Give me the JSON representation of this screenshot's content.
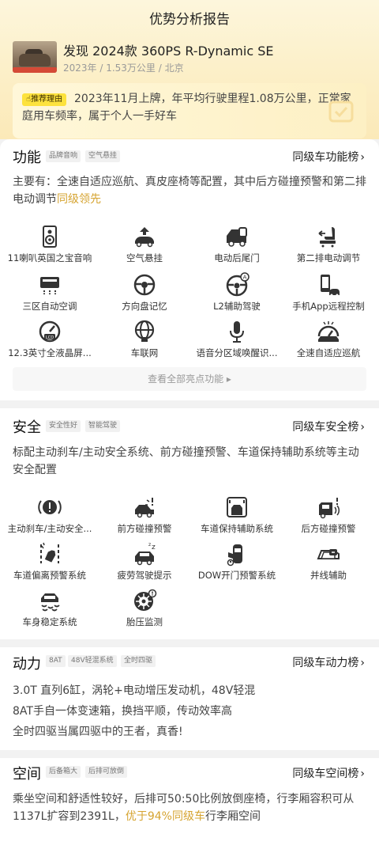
{
  "page_title": "优势分析报告",
  "car": {
    "name": "发现 2024款 360PS R-Dynamic SE",
    "meta": "2023年 / 1.53万公里 / 北京"
  },
  "reason": {
    "badge": "推荐理由",
    "text": "2023年11月上牌，年平均行驶里程1.08万公里，正常家庭用车频率，属于个人一手好车"
  },
  "function": {
    "title": "功能",
    "tags": [
      "品牌音响",
      "空气悬挂"
    ],
    "rank_link": "同级车功能榜",
    "desc_prefix": "主要有：全速自适应巡航、真皮座椅等配置，其中后方碰撞预警和第二排电动调节",
    "desc_highlight": "同级领先",
    "features": [
      {
        "icon": "speaker-icon",
        "label": "11喇叭英国之宝音响"
      },
      {
        "icon": "air-suspension-icon",
        "label": "空气悬挂"
      },
      {
        "icon": "power-tailgate-icon",
        "label": "电动后尾门"
      },
      {
        "icon": "power-seat-icon",
        "label": "第二排电动调节"
      },
      {
        "icon": "climate-control-icon",
        "label": "三区自动空调"
      },
      {
        "icon": "steering-wheel-icon",
        "label": "方向盘记忆"
      },
      {
        "icon": "driver-assist-icon",
        "label": "L2辅助驾驶"
      },
      {
        "icon": "phone-remote-icon",
        "label": "手机App远程控制"
      },
      {
        "icon": "lcd-gauge-icon",
        "label": "12.3英寸全液晶屏..."
      },
      {
        "icon": "connected-car-icon",
        "label": "车联网"
      },
      {
        "icon": "microphone-icon",
        "label": "语音分区域唤醒识..."
      },
      {
        "icon": "cruise-control-icon",
        "label": "全速自适应巡航"
      }
    ],
    "view_all": "查看全部亮点功能 ▸"
  },
  "safety": {
    "title": "安全",
    "tags": [
      "安全性好",
      "智能驾驶"
    ],
    "rank_link": "同级车安全榜",
    "desc": "标配主动刹车/主动安全系统、前方碰撞预警、车道保持辅助系统等主动安全配置",
    "features": [
      {
        "icon": "brake-warning-icon",
        "label": "主动刹车/主动安全..."
      },
      {
        "icon": "front-collision-icon",
        "label": "前方碰撞预警"
      },
      {
        "icon": "lane-keep-icon",
        "label": "车道保持辅助系统"
      },
      {
        "icon": "rear-collision-icon",
        "label": "后方碰撞预警"
      },
      {
        "icon": "lane-departure-icon",
        "label": "车道偏离预警系统"
      },
      {
        "icon": "fatigue-icon",
        "label": "疲劳驾驶提示"
      },
      {
        "icon": "door-open-warning-icon",
        "label": "DOW开门预警系统"
      },
      {
        "icon": "lane-merge-icon",
        "label": "并线辅助"
      },
      {
        "icon": "stability-icon",
        "label": "车身稳定系统"
      },
      {
        "icon": "tire-pressure-icon",
        "label": "胎压监测"
      }
    ]
  },
  "power": {
    "title": "动力",
    "tags": [
      "8AT",
      "48V轻混系统",
      "全时四驱"
    ],
    "rank_link": "同级车动力榜",
    "lines": [
      "3.0T 直列6缸，涡轮+电动增压发动机，48V轻混",
      "8AT手自一体变速箱，换挡平顺，传动效率高",
      "全时四驱当属四驱中的王者，真香!"
    ]
  },
  "space": {
    "title": "空间",
    "tags": [
      "后备箱大",
      "后排可放倒"
    ],
    "rank_link": "同级车空间榜",
    "desc_prefix": "乘坐空间和舒适性较好，后排可50:50比例放倒座椅，行李厢容积可从1137L扩容到2391L，",
    "desc_highlight": "优于94%同级车",
    "desc_suffix": "行李厢空间"
  },
  "colors": {
    "accent": "#d6a431",
    "badge": "#fde23d",
    "header_bg": "#fcefc7"
  }
}
